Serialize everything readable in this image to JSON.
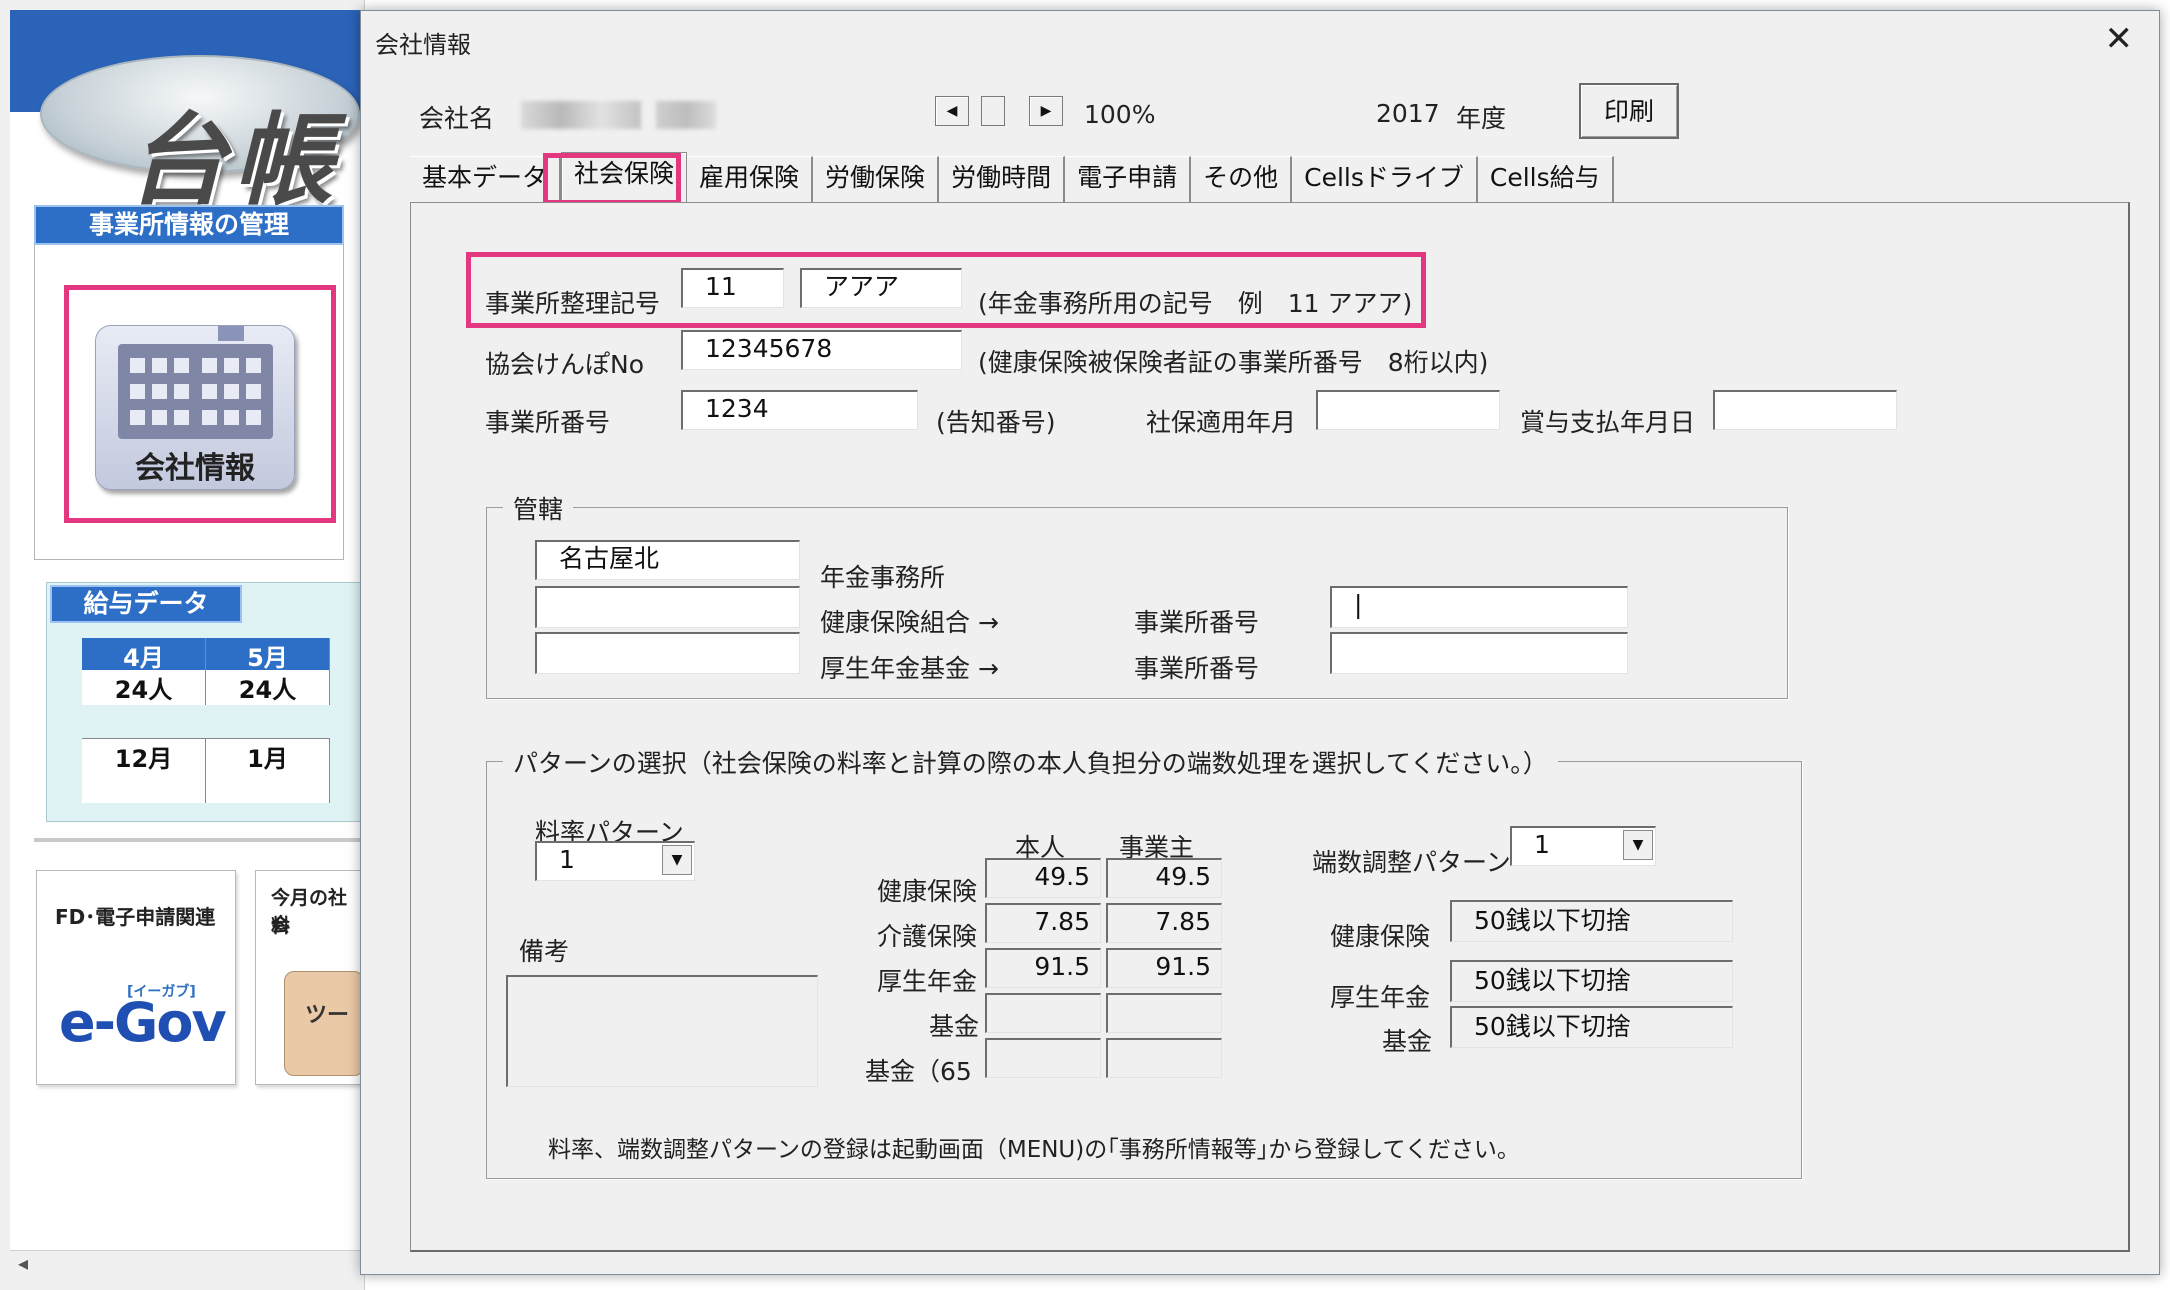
{
  "background": {
    "logo_text": "台帳",
    "office_panel_title": "事業所情報の管理",
    "company_button_label": "会社情報",
    "payroll_panel_title": "給与データ",
    "months_row1": [
      "4月",
      "5月"
    ],
    "counts_row1": [
      "24人",
      "24人"
    ],
    "months_row2": [
      "12月",
      "1月"
    ],
    "fd_card_title": "FD･電子申請関連",
    "egov_logo": "e-Gov",
    "egov_kana": "[イーガブ]",
    "monthly_card_title": "今月の社会保険料",
    "monthly_card_text1": "今月の社会",
    "monthly_card_text2": "料",
    "tool_label": "ツー",
    "scroll_left": "◂"
  },
  "dialog": {
    "title": "会社情報",
    "close_glyph": "✕",
    "company_label": "会社名",
    "zoom": "100%",
    "year": "2017",
    "year_label": "年度",
    "print_button": "印刷",
    "scroll_left": "◀",
    "scroll_right": "▶"
  },
  "tabs": [
    "基本データ",
    "社会保険",
    "雇用保険",
    "労働保険",
    "労働時間",
    "電子申請",
    "その他",
    "Cellsドライブ",
    "Cells給与"
  ],
  "selected_tab": "社会保険",
  "form": {
    "office_code_label": "事業所整理記号",
    "office_code_num": "11",
    "office_code_kana": "アアア",
    "office_code_note": "(年金事務所用の記号　例　11 アアア)",
    "kyokai_label": "協会けんぽNo",
    "kyokai_value": "12345678",
    "kyokai_note": "(健康保険被保険者証の事業所番号　8桁以内)",
    "office_no_label": "事業所番号",
    "office_no_value": "1234",
    "office_no_note": "(告知番号)",
    "apply_date_label": "社保適用年月",
    "apply_date_value": "",
    "bonus_date_label": "賞与支払年月日",
    "bonus_date_value": ""
  },
  "jurisdiction": {
    "title": "管轄",
    "pension_office_value": "名古屋北",
    "pension_office_label": "年金事務所",
    "health_union_value": "",
    "health_union_label": "健康保険組合 →",
    "health_office_label": "事業所番号",
    "health_office_value": "|",
    "pension_fund_value": "",
    "pension_fund_label": "厚生年金基金 →",
    "fund_office_label": "事業所番号",
    "fund_office_value": ""
  },
  "pattern": {
    "title": "パターンの選択（社会保険の料率と計算の際の本人負担分の端数処理を選択してください。）",
    "rate_pattern_label": "料率パターン",
    "rate_pattern_value": "1",
    "remarks_label": "備考",
    "remarks_value": "",
    "col_self": "本人",
    "col_employer": "事業主",
    "rows": [
      {
        "label": "健康保険",
        "self": "49.5",
        "employer": "49.5"
      },
      {
        "label": "介護保険",
        "self": "7.85",
        "employer": "7.85"
      },
      {
        "label": "厚生年金",
        "self": "91.5",
        "employer": "91.5"
      },
      {
        "label": "基金",
        "self": "",
        "employer": ""
      },
      {
        "label": "基金（65",
        "self": "",
        "employer": ""
      }
    ],
    "rounding_pattern_label": "端数調整パターン",
    "rounding_pattern_value": "1",
    "rounding_rows": [
      {
        "label": "健康保険",
        "value": "50銭以下切捨"
      },
      {
        "label": "厚生年金",
        "value": "50銭以下切捨"
      },
      {
        "label": "基金",
        "value": "50銭以下切捨"
      }
    ],
    "footer_note": "料率、端数調整パターンの登録は起動画面（MENU)の｢事務所情報等｣から登録してください。"
  },
  "colors": {
    "highlight": "#e3387f",
    "accent_blue": "#2d6fc6",
    "dialog_bg": "#f0f0f0"
  }
}
